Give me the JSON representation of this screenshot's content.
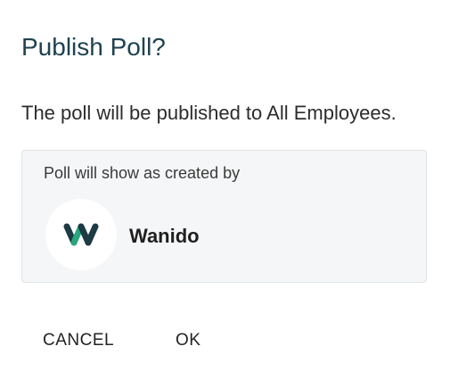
{
  "dialog": {
    "title": "Publish Poll?",
    "message": "The poll will be published to All Employees.",
    "creator": {
      "caption": "Poll will show as created by",
      "name": "Wanido",
      "logo_icon": "wanido-logo-icon"
    },
    "actions": {
      "cancel_label": "CANCEL",
      "ok_label": "OK"
    }
  },
  "colors": {
    "title": "#1f4250",
    "logo_dark": "#1d3a45",
    "logo_green": "#2aa67d",
    "card_bg": "#f5f6f7"
  }
}
